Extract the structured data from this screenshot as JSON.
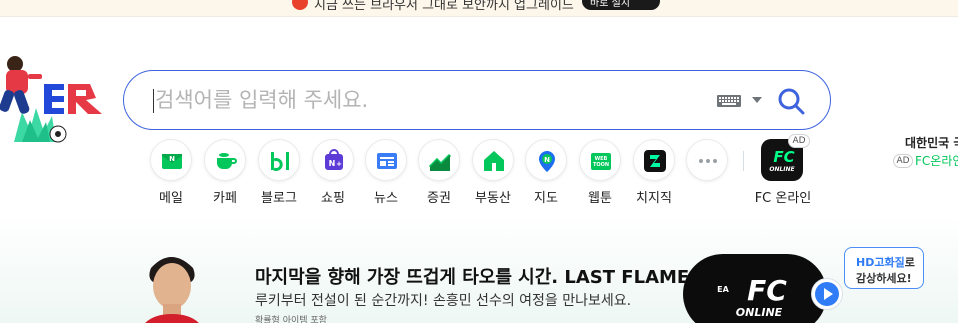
{
  "notice": {
    "text": "지금 쓰는 브라우저 그대로 보안까지 업그레이드",
    "button_label": "바로 설치"
  },
  "logo": {
    "label": "N",
    "alt": "doodle-logo"
  },
  "search": {
    "placeholder": "검색어를 입력해 주세요.",
    "value": ""
  },
  "shortcuts": [
    {
      "label": "메일",
      "icon": "mail-icon"
    },
    {
      "label": "카페",
      "icon": "cafe-icon"
    },
    {
      "label": "블로그",
      "icon": "blog-icon"
    },
    {
      "label": "쇼핑",
      "icon": "shopping-icon"
    },
    {
      "label": "뉴스",
      "icon": "news-icon"
    },
    {
      "label": "증권",
      "icon": "stock-icon"
    },
    {
      "label": "부동산",
      "icon": "realestate-icon"
    },
    {
      "label": "지도",
      "icon": "map-icon"
    },
    {
      "label": "웹툰",
      "icon": "webtoon-icon"
    },
    {
      "label": "치지직",
      "icon": "chzzk-icon"
    },
    {
      "label": "",
      "icon": "more-icon"
    }
  ],
  "ad_shortcut": {
    "label": "FC 온라인",
    "badge": "AD",
    "game_text": "FC",
    "game_sub": "ONLINE"
  },
  "right_widget": {
    "title": "대한민국 국",
    "ad_badge": "AD",
    "link_text": "FC온라인"
  },
  "banner": {
    "title": "마지막을 향해 가장 뜨겁게 타오를 시간. LAST FLAME.",
    "subtitle": "루키부터 전설이 된 순간까지! 손흥민 선수의 여정을 만나보세요.",
    "note": "확률형 아이템 포함",
    "card_text": "FC",
    "card_sub": "ONLINE",
    "card_brand": "EA",
    "tooltip_line1_highlight": "HD고화질",
    "tooltip_line1_rest": "로",
    "tooltip_line2": "감상하세요!"
  },
  "colors": {
    "accent_blue": "#3e63dd",
    "naver_green": "#03c75a",
    "play_blue": "#2f7cf6"
  }
}
